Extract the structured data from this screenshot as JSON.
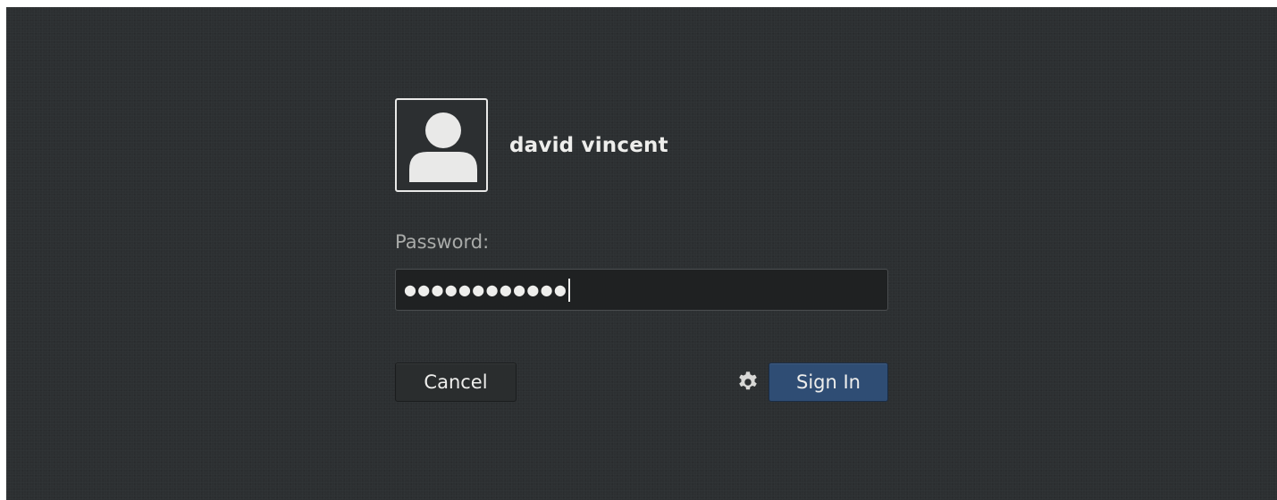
{
  "user": {
    "name": "david vincent",
    "avatar_icon": "user-avatar-icon"
  },
  "password": {
    "label": "Password:",
    "masked_value": "●●●●●●●●●●●●"
  },
  "actions": {
    "cancel_label": "Cancel",
    "signin_label": "Sign In",
    "session_icon": "gear-icon"
  },
  "colors": {
    "background": "#2c2f31",
    "accent": "#2f4d74",
    "text": "#eeeeec"
  }
}
